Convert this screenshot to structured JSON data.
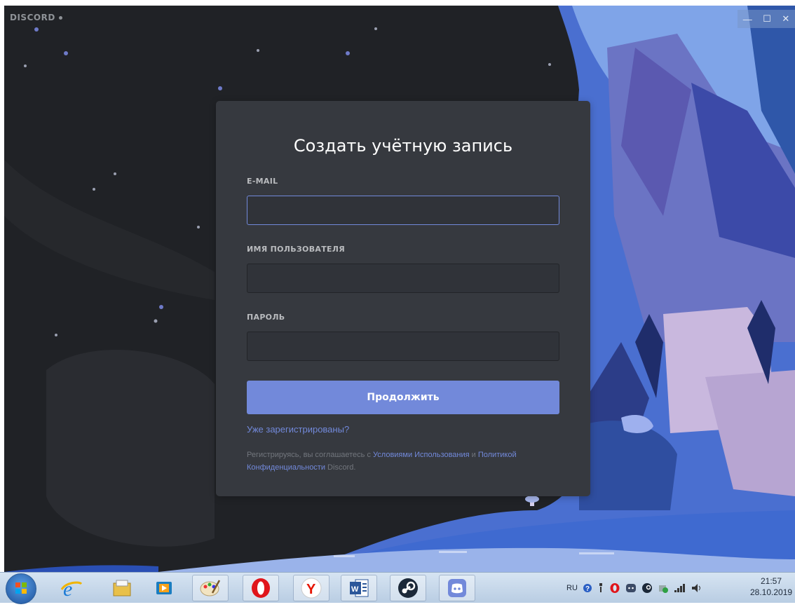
{
  "app": {
    "brand": "DISCORD"
  },
  "window_controls": {
    "minimize": "—",
    "maximize": "☐",
    "close": "✕"
  },
  "form": {
    "title": "Создать учётную запись",
    "email_label": "E-MAIL",
    "email_value": "",
    "username_label": "ИМЯ ПОЛЬЗОВАТЕЛЯ",
    "username_value": "",
    "password_label": "ПАРОЛЬ",
    "password_value": "",
    "continue_button": "Продолжить",
    "login_link": "Уже зарегистрированы?",
    "terms_prefix": "Регистрируясь, вы соглашаетесь с ",
    "terms_link": "Условиями Использования",
    "terms_and": " и ",
    "privacy_link_1": "Политикой",
    "privacy_link_2": "Конфиденциальности",
    "terms_suffix": " Discord."
  },
  "colors": {
    "blurple": "#7289da",
    "modal_bg": "#36393f",
    "input_bg": "#303339"
  },
  "taskbar": {
    "apps": [
      "start-orb-icon",
      "internet-explorer-icon",
      "file-explorer-icon",
      "media-player-icon",
      "paint-icon",
      "opera-icon",
      "yandex-browser-icon",
      "word-icon",
      "steam-icon",
      "discord-icon"
    ],
    "language": "RU",
    "tray_icons": [
      "help-icon",
      "network-icon",
      "opera-tray-icon",
      "discord-tray-icon",
      "steam-tray-icon",
      "safely-remove-icon",
      "signal-icon",
      "volume-icon"
    ],
    "time": "21:57",
    "date": "28.10.2019"
  }
}
